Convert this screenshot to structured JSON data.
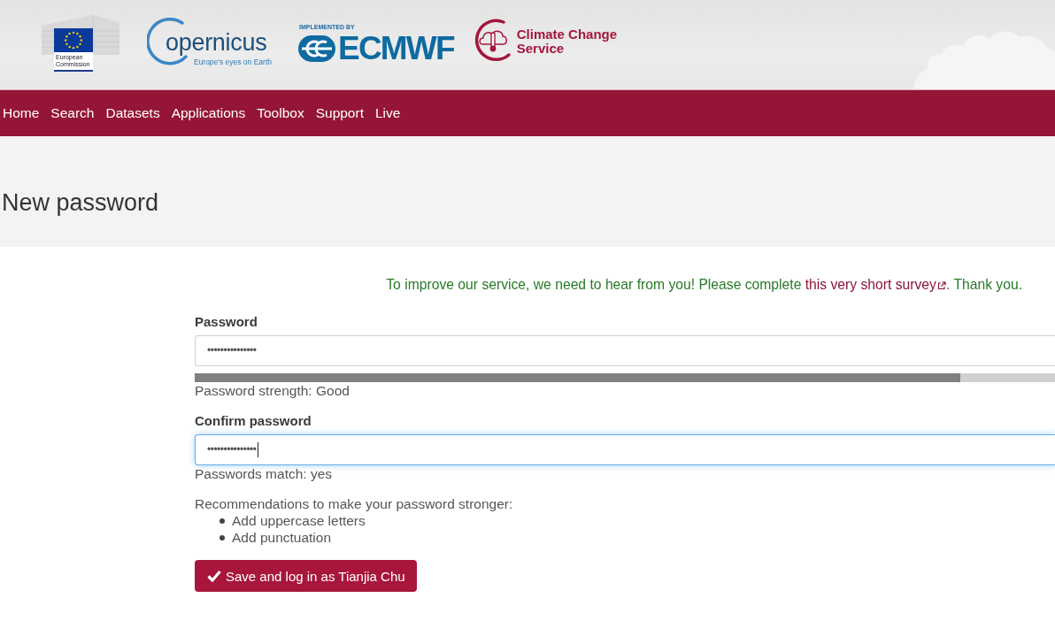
{
  "header": {
    "eu_logo": {
      "caption": [
        "European",
        "Commission"
      ]
    },
    "copernicus_logo": {
      "wordmark": "opernicus",
      "tagline": "Europe's eyes on Earth"
    },
    "ecmwf_logo": {
      "overline": "IMPLEMENTED BY",
      "wordmark": "ECMWF"
    },
    "c3s_logo": {
      "lines": [
        "Climate Change",
        "Service"
      ]
    }
  },
  "nav": {
    "items": [
      "Home",
      "Search",
      "Datasets",
      "Applications",
      "Toolbox",
      "Support",
      "Live"
    ]
  },
  "page_title": "New password",
  "notice": {
    "text": "To improve our service, we need to hear from you! Please complete ",
    "link": "this very short survey",
    "text_end": ". Thank you."
  },
  "form": {
    "password": {
      "label": "Password",
      "value": "•••••••••••••••",
      "focused": false
    },
    "strength": {
      "level": 0.89,
      "text": "Password strength: Good"
    },
    "confirm": {
      "label": "Confirm password",
      "value": "•••••••••••••••",
      "focused": true
    },
    "match_text": "Passwords match: yes",
    "recommendations": {
      "heading": "Recommendations to make your password stronger:",
      "items": [
        "Add uppercase letters",
        "Add punctuation"
      ]
    },
    "submit_button": {
      "label": "Save and log in as Tianjia Chu"
    }
  }
}
